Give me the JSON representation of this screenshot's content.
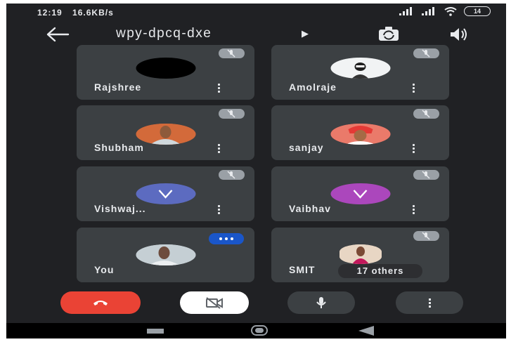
{
  "status_bar": {
    "time": "12:19",
    "net_speed": "16.6KB/s",
    "battery": "14"
  },
  "header": {
    "meeting_code": "wpy-dpcq-dxe",
    "icons": [
      "back-arrow-icon",
      "caret-right-icon",
      "switch-camera-icon",
      "speaker-icon"
    ]
  },
  "participants": [
    {
      "name": "Rajshree",
      "avatar": "photo",
      "mic": "muted"
    },
    {
      "name": "Amolraje",
      "avatar": "photo",
      "mic": "muted"
    },
    {
      "name": "Shubham",
      "avatar": "photo",
      "mic": "muted"
    },
    {
      "name": "sanjay",
      "avatar": "photo",
      "mic": "muted"
    },
    {
      "name": "Vishwaj...",
      "avatar": "initial",
      "initial": "V",
      "avatar_color": "#5c6bc0",
      "mic": "muted"
    },
    {
      "name": "Vaibhav",
      "avatar": "initial",
      "initial": "V",
      "avatar_color": "#ab47bc",
      "mic": "muted"
    },
    {
      "name": "You",
      "avatar": "photo",
      "mic": "speaking"
    },
    {
      "name": "SMIT",
      "avatar": "photo",
      "mic": "muted",
      "others_label": "17 others"
    }
  ],
  "controls": {
    "end_call": {
      "icon": "phone-hangup-icon",
      "color": "#ea4335"
    },
    "camera": {
      "icon": "camera-off-icon",
      "color": "#ffffff"
    },
    "mic": {
      "icon": "microphone-icon",
      "color": "#3c4043"
    },
    "more": {
      "icon": "more-vert-icon",
      "color": "#3c4043"
    }
  },
  "nav_bar": [
    "recents-icon",
    "home-icon",
    "back-icon"
  ]
}
